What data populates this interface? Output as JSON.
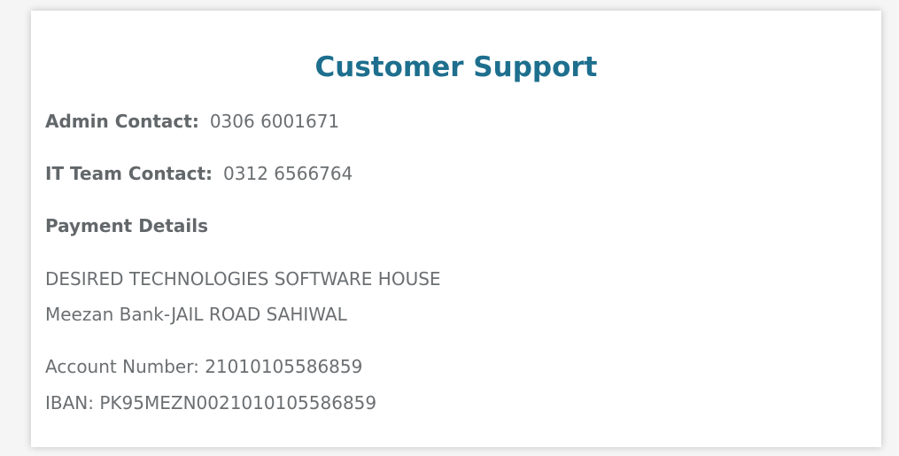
{
  "title": "Customer Support",
  "contacts": {
    "admin_label": "Admin Contact:",
    "admin_value": "0306 6001671",
    "it_label": "IT Team Contact:",
    "it_value": "0312 6566764"
  },
  "payment": {
    "heading": "Payment Details",
    "company": "DESIRED TECHNOLOGIES SOFTWARE HOUSE",
    "bank": "Meezan Bank-JAIL ROAD SAHIWAL",
    "account": "Account Number: 21010105586859",
    "iban": "IBAN: PK95MEZN0021010105586859"
  },
  "colors": {
    "title": "#1e6f8e",
    "text": "#6b6f72",
    "background": "#ffffff"
  }
}
